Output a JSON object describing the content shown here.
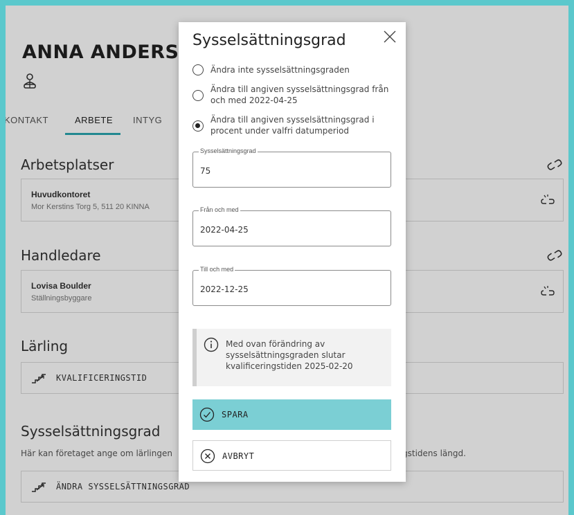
{
  "person": {
    "name": "ANNA ANDERSSON"
  },
  "tabs": [
    {
      "label": "KONTAKT"
    },
    {
      "label": "ARBETE"
    },
    {
      "label": "INTYG"
    }
  ],
  "sections": {
    "workplaces": {
      "title": "Arbetsplatser",
      "item": {
        "title": "Huvudkontoret",
        "subtitle": "Mor Kerstins Torg 5, 511 20 KINNA"
      }
    },
    "supervisor": {
      "title": "Handledare",
      "item": {
        "title": "Lovisa Boulder",
        "subtitle": "Ställningsbyggare"
      }
    },
    "apprentice": {
      "title": "Lärling",
      "button_label": "KVALIFICERINGSTID"
    },
    "employment": {
      "title": "Sysselsättningsgrad",
      "description_start": "Här kan företaget ange om lärlingen",
      "description_end": "gstidens längd.",
      "button_label": "ÄNDRA SYSSELSÄTTNINGSGRAD"
    }
  },
  "modal": {
    "title": "Sysselsättningsgrad",
    "options": [
      {
        "label": "Ändra inte sysselsättningsgraden",
        "selected": false
      },
      {
        "label": "Ändra till angiven sysselsättningsgrad från och med 2022-04-25",
        "selected": false
      },
      {
        "label": "Ändra till angiven sysselsättningsgrad i procent under valfri datumperiod",
        "selected": true
      }
    ],
    "fields": {
      "rate": {
        "label": "Sysselsättningsgrad",
        "value": "75"
      },
      "from": {
        "label": "Från och med",
        "value": "2022-04-25"
      },
      "to": {
        "label": "Till och med",
        "value": "2022-12-25"
      }
    },
    "info_text": "Med ovan förändring av sysselsättningsgraden slutar kvalificeringstiden 2025-02-20",
    "save_label": "SPARA",
    "cancel_label": "AVBRYT"
  },
  "colors": {
    "frame": "#5bc8cc",
    "accent": "#2aa6b0",
    "save_button": "#7bcfd4"
  },
  "icons": [
    "person-icon",
    "link-icon",
    "unlink-icon",
    "stairs-icon",
    "close-icon",
    "info-icon",
    "check-circle-icon",
    "x-circle-icon"
  ]
}
